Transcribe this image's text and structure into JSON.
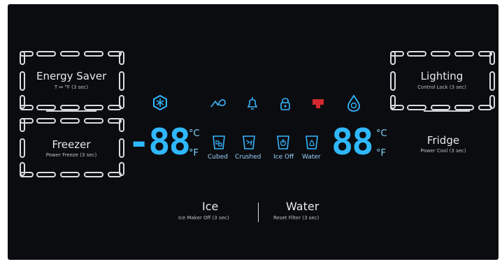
{
  "buttons": {
    "energy_saver": {
      "title": "Energy Saver",
      "sub": "T ↔ °F (3 sec)"
    },
    "freezer": {
      "title": "Freezer",
      "sub": "Power Freeze (3 sec)"
    },
    "lighting": {
      "title": "Lighting",
      "sub": "Control Lock (3 sec)"
    },
    "fridge": {
      "title": "Fridge",
      "sub": "Power Cool (3 sec)"
    },
    "ice": {
      "title": "Ice",
      "sub": "Ice Maker Off (3 sec)"
    },
    "water": {
      "title": "Water",
      "sub": "Reset Filter (3 sec)"
    }
  },
  "display": {
    "freezer_temp": "-88",
    "fridge_temp": "88",
    "unit_c": "°C",
    "unit_f": "°F"
  },
  "dispenser_modes": {
    "cubed": "Cubed",
    "crushed": "Crushed",
    "ice_off": "Ice Off",
    "water": "Water"
  },
  "colors": {
    "display_blue": "#2fb8ff",
    "filter_red": "#d3282f",
    "panel": "#0b0c0f"
  }
}
